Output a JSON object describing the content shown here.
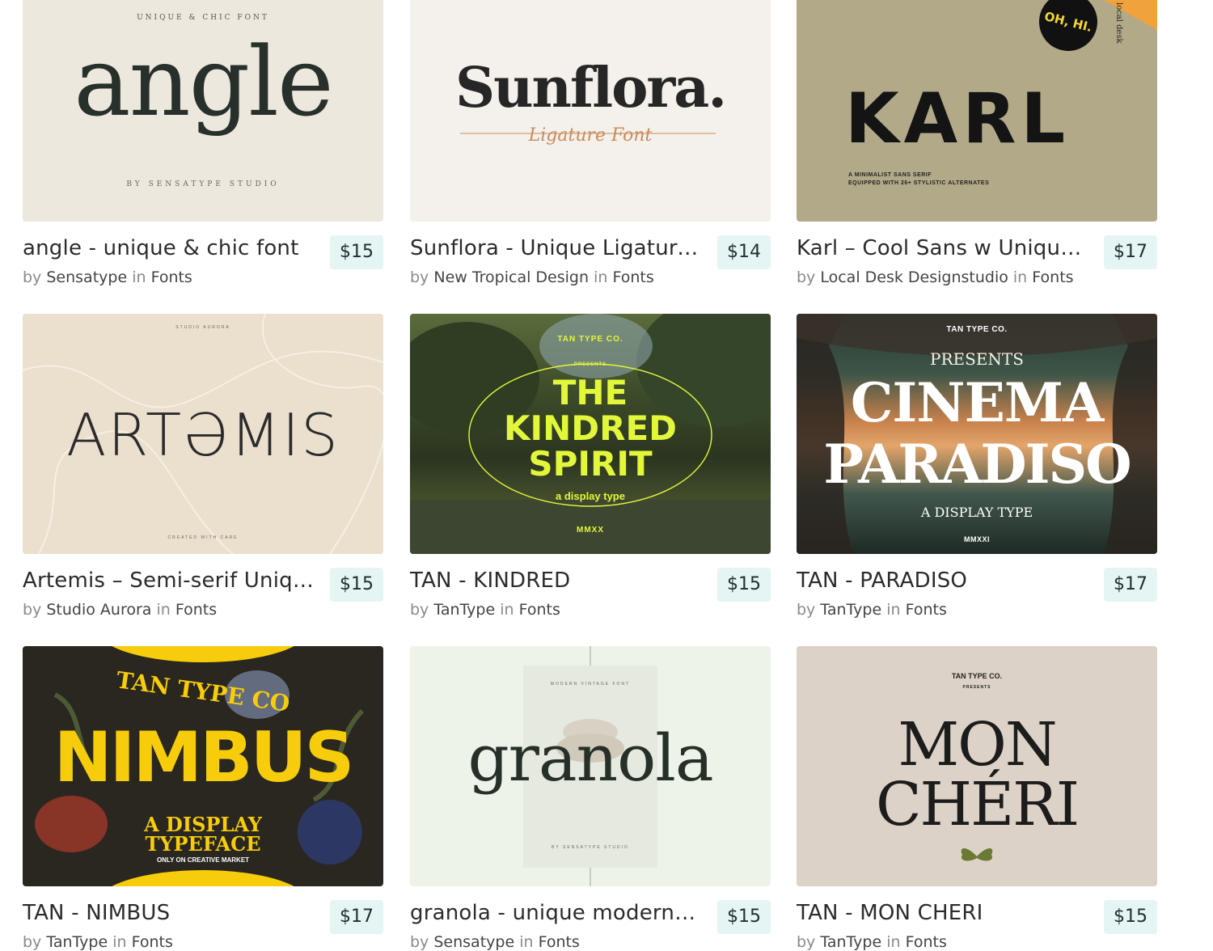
{
  "products": [
    {
      "title": "angle - unique & chic font",
      "price": "$15",
      "by": "by",
      "author": "Sensatype",
      "in": "in",
      "category": "Fonts",
      "thumb": {
        "top": "UNIQUE & CHIC FONT",
        "main": "angle",
        "bottom": "BY SENSATYPE STUDIO",
        "bg": "#ede8de"
      }
    },
    {
      "title": "Sunflora - Unique Ligature Font",
      "price": "$14",
      "by": "by",
      "author": "New Tropical Design",
      "in": "in",
      "category": "Fonts",
      "thumb": {
        "main": "Sunflora.",
        "script": "Ligature Font",
        "bg": "#f4f1ec"
      }
    },
    {
      "title": "Karl – Cool Sans w Unique Alternates",
      "price": "$17",
      "by": "by",
      "author": "Local Desk Designstudio",
      "in": "in",
      "category": "Fonts",
      "thumb": {
        "main": "KARL",
        "badge": "OH, HI.",
        "corner": "local desk",
        "sub1": "A MINIMALIST SANS SERIF",
        "sub2": "EQUIPPED WITH 26+ STYLISTIC ALTERNATES",
        "bg": "#b2a988"
      }
    },
    {
      "title": "Artemis – Semi-serif Unique Font",
      "price": "$15",
      "by": "by",
      "author": "Studio Aurora",
      "in": "in",
      "category": "Fonts",
      "thumb": {
        "top": "STUDIO AURORA",
        "main": "ARTƏMIS",
        "bottom": "CREATED WITH CARE",
        "bg": "#ebdfce"
      }
    },
    {
      "title": "TAN - KINDRED",
      "price": "$15",
      "by": "by",
      "author": "TanType",
      "in": "in",
      "category": "Fonts",
      "thumb": {
        "top": "TAN TYPE CO.",
        "pre": "PRESENTS",
        "l1": "THE",
        "l2": "KINDRED",
        "l3": "SPIRIT",
        "sub": "a display type",
        "year": "MMXX"
      }
    },
    {
      "title": "TAN - PARADISO",
      "price": "$17",
      "by": "by",
      "author": "TanType",
      "in": "in",
      "category": "Fonts",
      "thumb": {
        "top": "TAN TYPE CO.",
        "pre": "PRESENTS",
        "l1": "CINEMA",
        "l2": "PARADISO",
        "sub": "A DISPLAY TYPE",
        "year": "MMXXI"
      }
    },
    {
      "title": "TAN - NIMBUS",
      "price": "$17",
      "by": "by",
      "author": "TanType",
      "in": "in",
      "category": "Fonts",
      "thumb": {
        "top": "TAN TYPE CO",
        "main": "NIMBUS",
        "sub1": "A DISPLAY",
        "sub2": "TYPEFACE",
        "sub3": "ONLY ON CREATIVE MARKET"
      }
    },
    {
      "title": "granola - unique modern vintage font",
      "price": "$15",
      "by": "by",
      "author": "Sensatype",
      "in": "in",
      "category": "Fonts",
      "thumb": {
        "top": "MODERN VINTAGE FONT",
        "main": "granola",
        "bottom": "BY SENSATYPE STUDIO"
      }
    },
    {
      "title": "TAN - MON CHERI",
      "price": "$15",
      "by": "by",
      "author": "TanType",
      "in": "in",
      "category": "Fonts",
      "thumb": {
        "top": "TAN TYPE CO.",
        "pre": "PRESENTS",
        "l1": "MON",
        "l2": "CHÉRI"
      }
    }
  ],
  "colors": {
    "price_bg": "#e5f5f4",
    "kindred_text": "#e3f73a",
    "nimbus_yellow": "#f7cd0b"
  }
}
